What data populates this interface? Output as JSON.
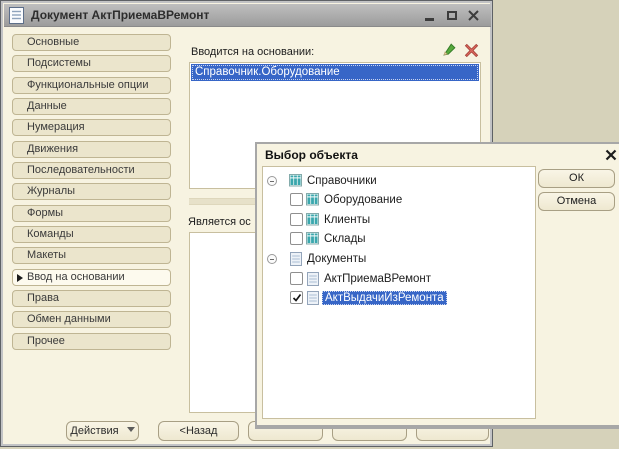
{
  "window": {
    "title": "Документ АктПриемаВРемонт",
    "tabs": [
      {
        "label": "Основные"
      },
      {
        "label": "Подсистемы"
      },
      {
        "label": "Функциональные опции"
      },
      {
        "label": "Данные"
      },
      {
        "label": "Нумерация"
      },
      {
        "label": "Движения"
      },
      {
        "label": "Последовательности"
      },
      {
        "label": "Журналы"
      },
      {
        "label": "Формы"
      },
      {
        "label": "Команды"
      },
      {
        "label": "Макеты"
      },
      {
        "label": "Ввод на основании",
        "active": true
      },
      {
        "label": "Права"
      },
      {
        "label": "Обмен данными"
      },
      {
        "label": "Прочее"
      }
    ],
    "based_on": {
      "label": "Вводится на основании:",
      "items": [
        {
          "text": "Справочник.Оборудование",
          "selected": true
        }
      ]
    },
    "basis_for": {
      "label": "Является ос"
    },
    "footer": {
      "actions_label": "Действия",
      "back_label": "<Назад"
    }
  },
  "dialog": {
    "title": "Выбор объекта",
    "tree": {
      "groups": [
        {
          "label": "Справочники",
          "icon": "catalog-icon",
          "expanded": true,
          "children": [
            {
              "label": "Оборудование",
              "checked": false
            },
            {
              "label": "Клиенты",
              "checked": false
            },
            {
              "label": "Склады",
              "checked": false
            }
          ]
        },
        {
          "label": "Документы",
          "icon": "document-icon",
          "expanded": true,
          "children": [
            {
              "label": "АктПриемаВРемонт",
              "checked": false
            },
            {
              "label": "АктВыдачиИзРемонта",
              "checked": true,
              "selected": true
            }
          ]
        }
      ]
    },
    "ok_label": "ОК",
    "cancel_label": "Отмена"
  },
  "colors": {
    "selection_blue": "#3766c7",
    "window_bg": "#f7f3e1",
    "desktop_bg": "#d6d2ba",
    "tab_bg": "#ebe5cc",
    "edit_green": "#4aa23c",
    "delete_red": "#d05a50",
    "titlebar_gray": "#a8a8a8"
  }
}
